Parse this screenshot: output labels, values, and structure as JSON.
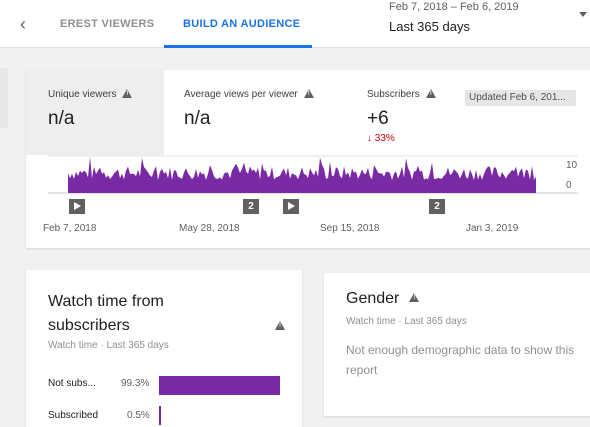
{
  "tabs": {
    "back_glyph": "‹",
    "inactive": "EREST VIEWERS",
    "active": "BUILD AN AUDIENCE"
  },
  "date": {
    "range": "Feb 7, 2018 – Feb 6, 2019",
    "value": "Last 365 days"
  },
  "metrics": {
    "unique_viewers": {
      "label": "Unique viewers",
      "value": "n/a"
    },
    "avg_views": {
      "label": "Average views per viewer",
      "value": "n/a"
    },
    "subscribers": {
      "label": "Subscribers",
      "value": "+6",
      "delta": "↓ 33%"
    },
    "updated": "Updated Feb 6, 201..."
  },
  "chart_data": {
    "type": "area",
    "x_ticks": [
      "Feb 7, 2018",
      "May 28, 2018",
      "Sep 15, 2018",
      "Jan 3, 2019"
    ],
    "y_ticks": [
      "10",
      "0"
    ],
    "ylim": [
      0,
      10
    ],
    "color": "#7b2aa5",
    "markers": [
      {
        "kind": "play",
        "label": ""
      },
      {
        "kind": "info",
        "label": "2"
      },
      {
        "kind": "play",
        "label": ""
      },
      {
        "kind": "info",
        "label": "2"
      }
    ]
  },
  "watch_time": {
    "title": "Watch time from subscribers",
    "subtitle": "Watch time · Last 365 days",
    "rows": [
      {
        "label": "Not subs...",
        "pct": "99.3%",
        "value": 99.3
      },
      {
        "label": "Subscribed",
        "pct": "0.5%",
        "value": 0.5
      }
    ]
  },
  "gender": {
    "title": "Gender",
    "subtitle": "Watch time · Last 365 days",
    "message": "Not enough demographic data to show this report"
  },
  "colors": {
    "accent": "#1a73e8",
    "bar": "#7b2aa5",
    "delta": "#cc0000"
  }
}
